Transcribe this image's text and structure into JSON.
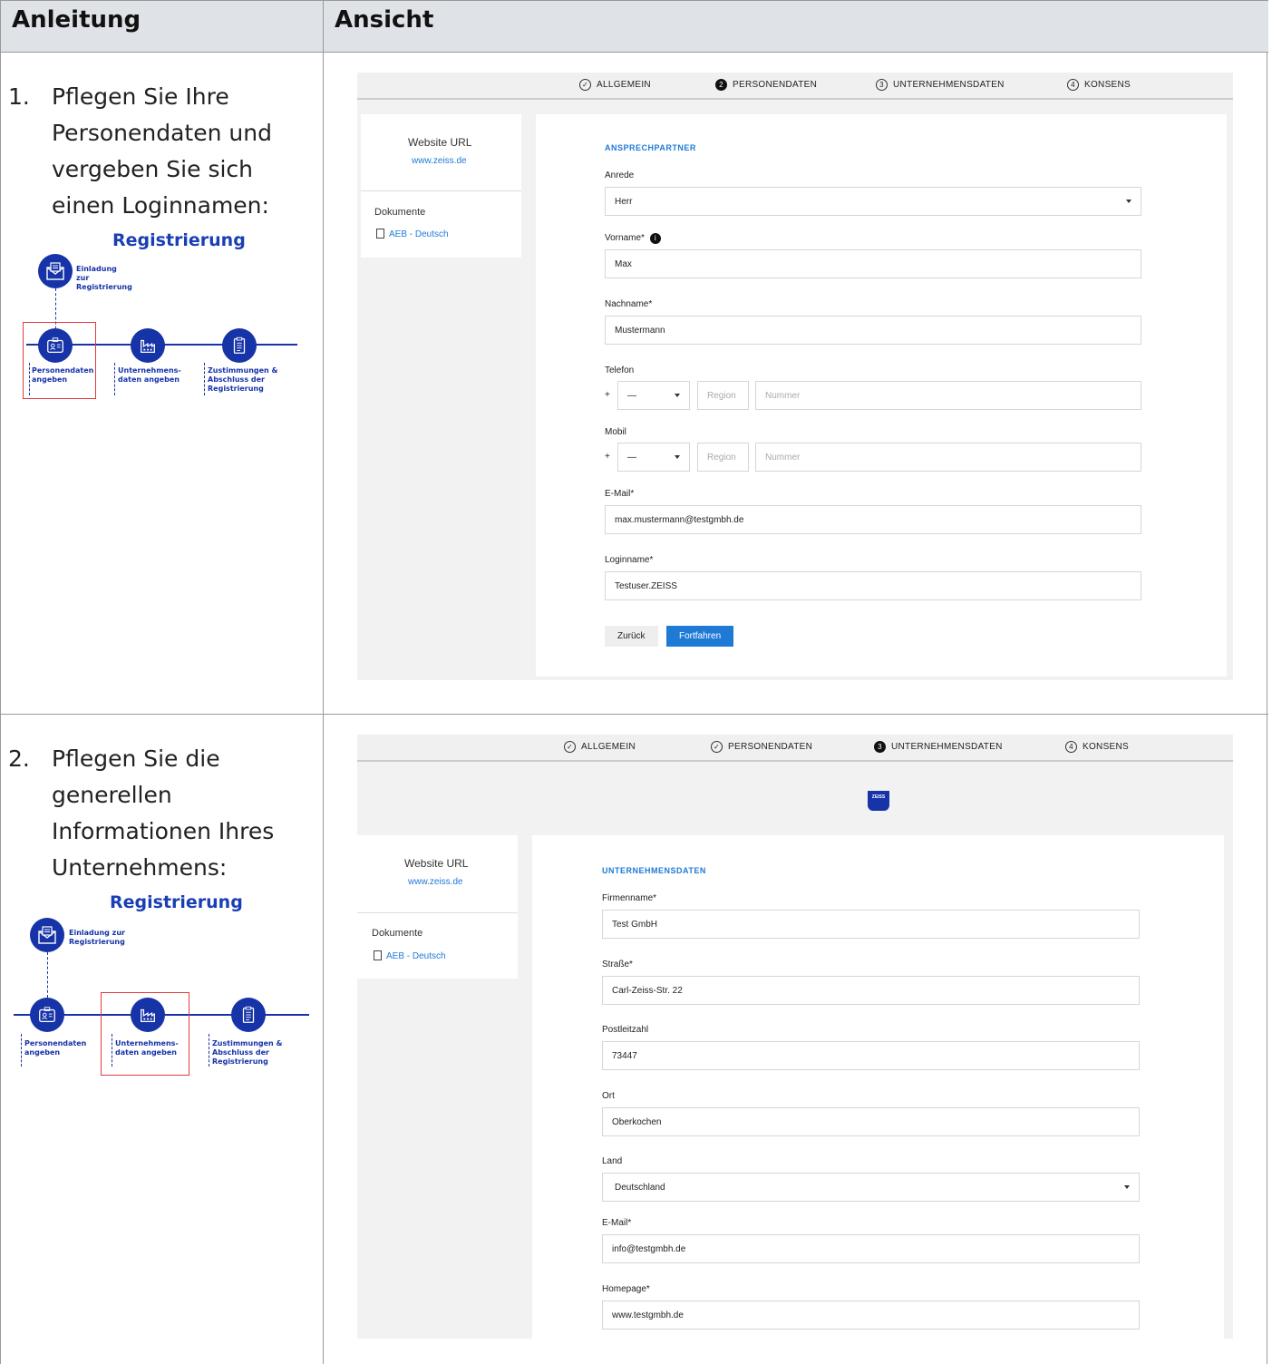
{
  "header": {
    "col1": "Anleitung",
    "col2": "Ansicht"
  },
  "rows": [
    {
      "num": "1.",
      "text": "Pflegen Sie Ihre Personendaten und vergeben Sie sich einen Loginnamen:",
      "diagram": {
        "title": "Registrierung",
        "invitation": "Einladung zur Registrierung",
        "step1": "Personendaten angeben",
        "step2": "Unternehmens-daten angeben",
        "step3": "Zustimmungen & Abschluss der Registrierung"
      }
    },
    {
      "num": "2.",
      "text": "Pflegen Sie die generellen Informationen Ihres Unternehmens:",
      "diagram": {
        "title": "Registrierung",
        "invitation": "Einladung zur Registrierung",
        "step1": "Personendaten angeben",
        "step2": "Unternehmens-daten angeben",
        "step3": "Zustimmungen & Abschluss der Registrierung"
      }
    }
  ],
  "stepper": {
    "s1": "ALLGEMEIN",
    "s2": "PERSONENDATEN",
    "s3": "UNTERNEHMENSDATEN",
    "s4": "KONSENS",
    "n2": "2",
    "n3": "3",
    "n4": "4"
  },
  "sidebar": {
    "url_label": "Website URL",
    "url": "www.zeiss.de",
    "docs_label": "Dokumente",
    "doc": "AEB - Deutsch"
  },
  "shot1": {
    "section": "ANSPRECHPARTNER",
    "anrede_label": "Anrede",
    "anrede": "Herr",
    "vorname_label": "Vorname*",
    "vorname": "Max",
    "nachname_label": "Nachname*",
    "nachname": "Mustermann",
    "telefon_label": "Telefon",
    "mobil_label": "Mobil",
    "plus": "+",
    "dash": "—",
    "region_ph": "Region",
    "nummer_ph": "Nummer",
    "email_label": "E-Mail*",
    "email": "max.mustermann@testgmbh.de",
    "login_label": "Loginname*",
    "login": "Testuser.ZEISS",
    "back": "Zurück",
    "next": "Fortfahren"
  },
  "shot2": {
    "logo": "ZEISS",
    "section": "UNTERNEHMENSDATEN",
    "firma_label": "Firmenname*",
    "firma": "Test GmbH",
    "strasse_label": "Straße*",
    "strasse": "Carl-Zeiss-Str. 22",
    "plz_label": "Postleitzahl",
    "plz": "73447",
    "ort_label": "Ort",
    "ort": "Oberkochen",
    "land_label": "Land",
    "land": "Deutschland",
    "email_label": "E-Mail*",
    "email": "info@testgmbh.de",
    "homepage_label": "Homepage*",
    "homepage": "www.testgmbh.de"
  },
  "colors": {
    "accent": "#1f7ad6",
    "brand": "#1633a8",
    "highlight": "#e23b3b"
  }
}
